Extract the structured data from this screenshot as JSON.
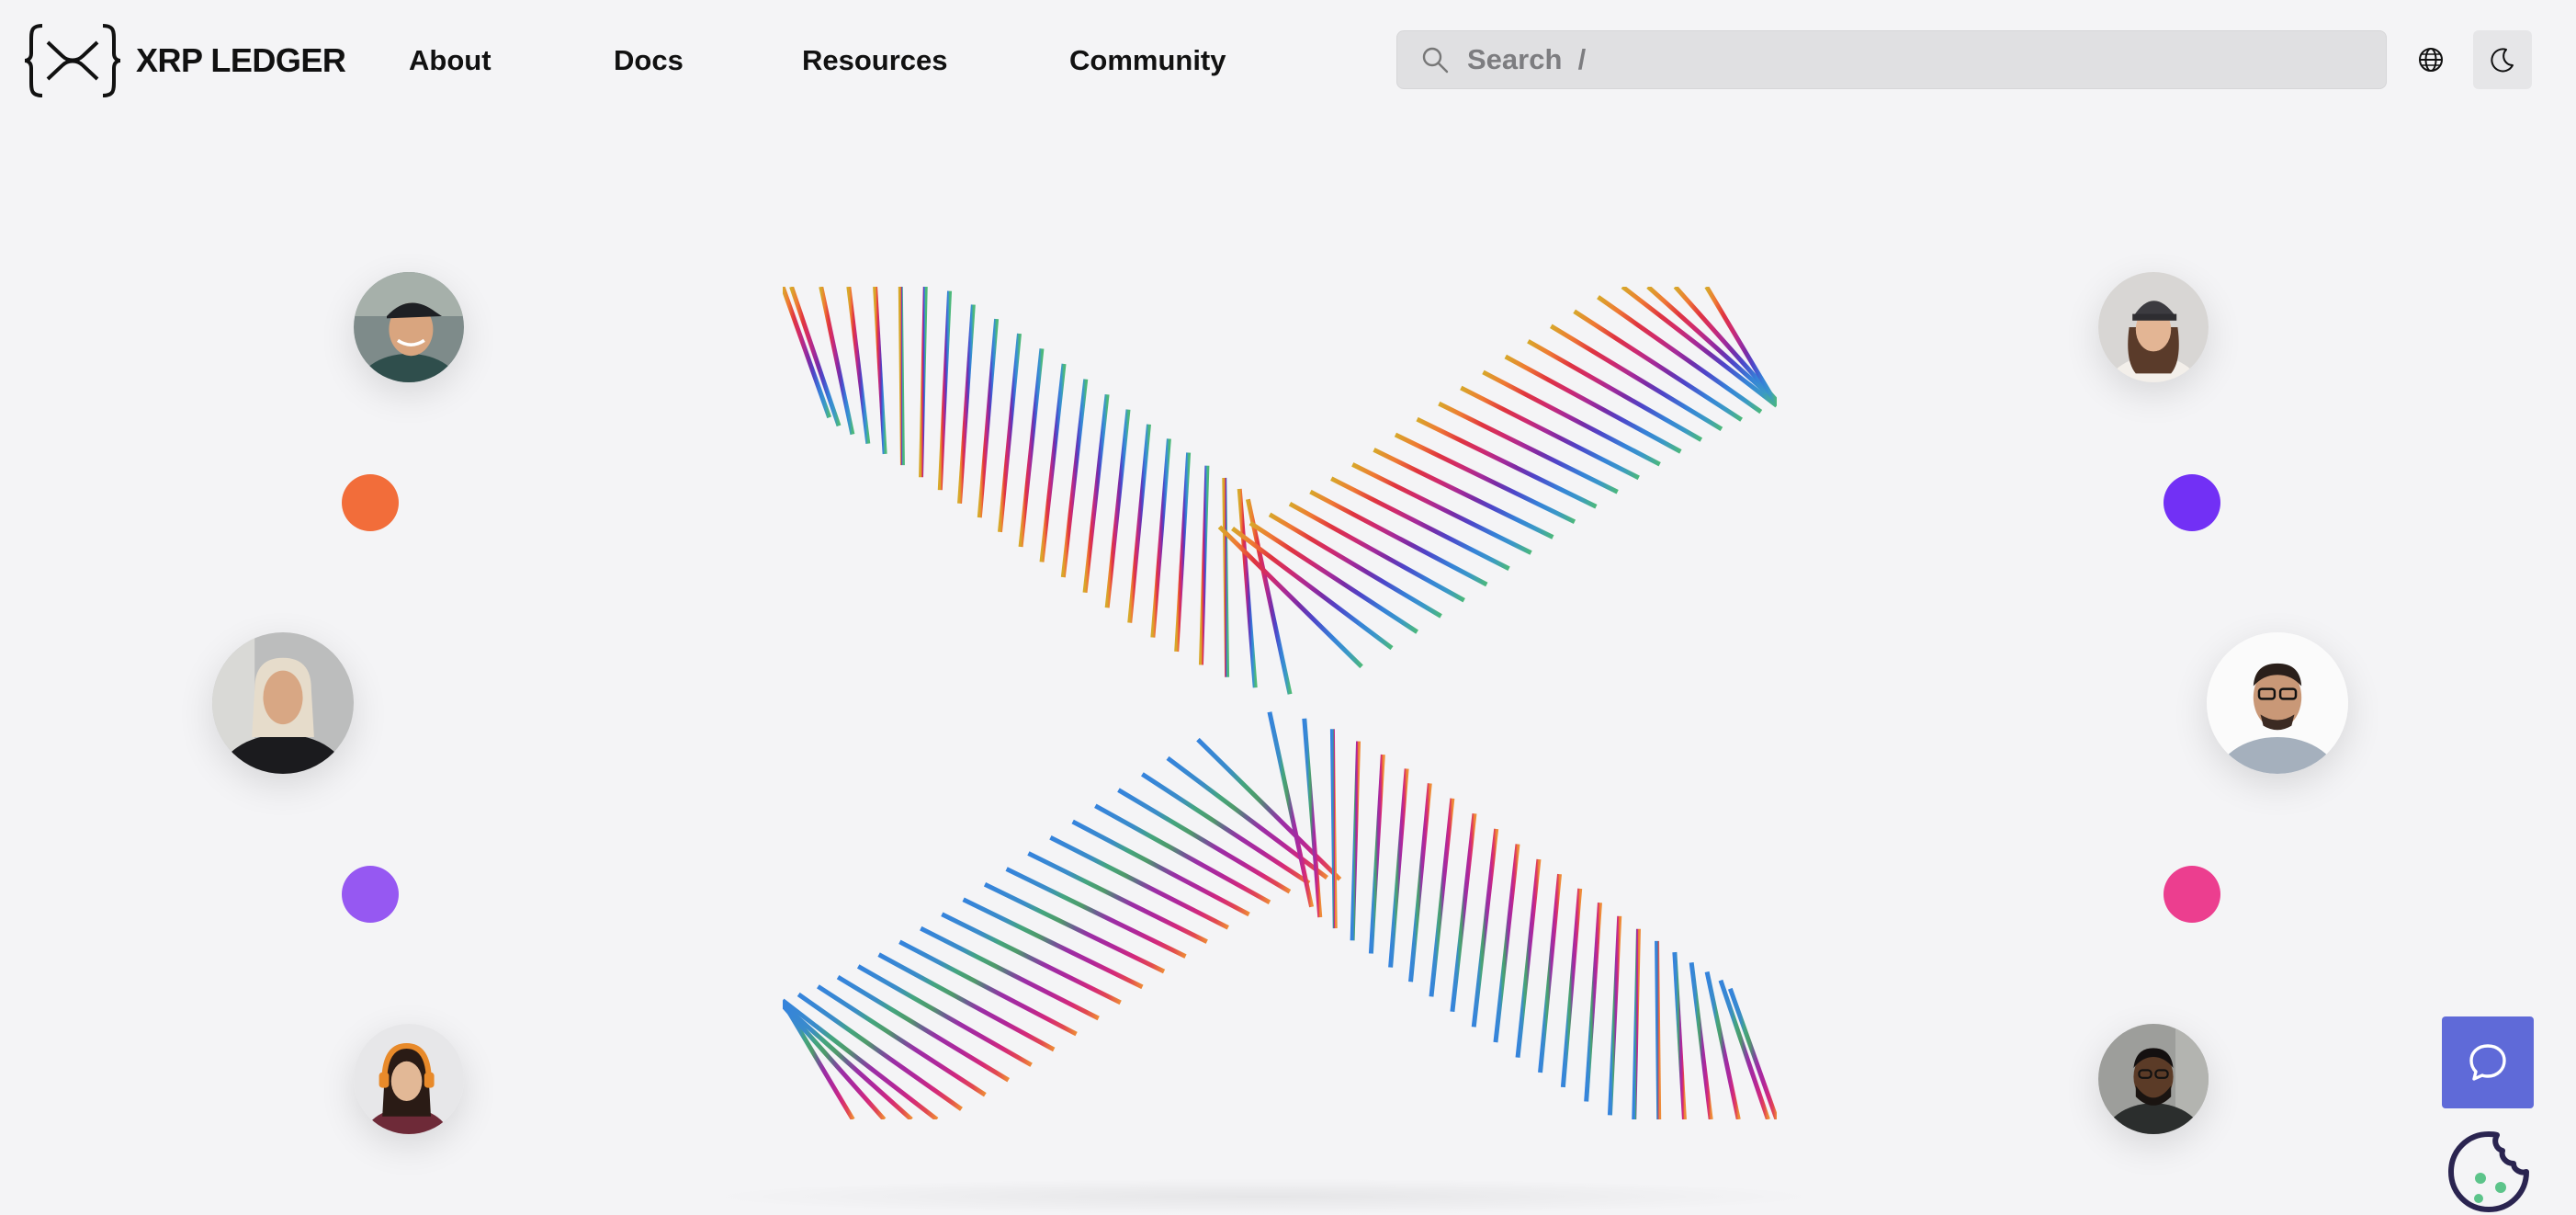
{
  "brand": {
    "name": "XRP LEDGER",
    "logo_icon": "xrpl-bracket-x-icon"
  },
  "nav": {
    "links": [
      {
        "label": "About"
      },
      {
        "label": "Docs"
      },
      {
        "label": "Resources"
      },
      {
        "label": "Community"
      }
    ]
  },
  "search": {
    "placeholder": "Search  /",
    "icon": "search-icon"
  },
  "toolbar": {
    "language_icon": "globe-icon",
    "theme_icon": "moon-icon"
  },
  "hero": {
    "art_icon": "xrp-x-striped-graphic",
    "dot_colors": {
      "orange": "#f26d3a",
      "violet": "#7230f5",
      "purple": "#9658f2",
      "pink": "#ec3e8f"
    }
  },
  "widgets": {
    "chat_icon": "chat-bubble-icon",
    "chat_color": "#5f6ad8",
    "cookie_icon": "cookie-icon"
  }
}
